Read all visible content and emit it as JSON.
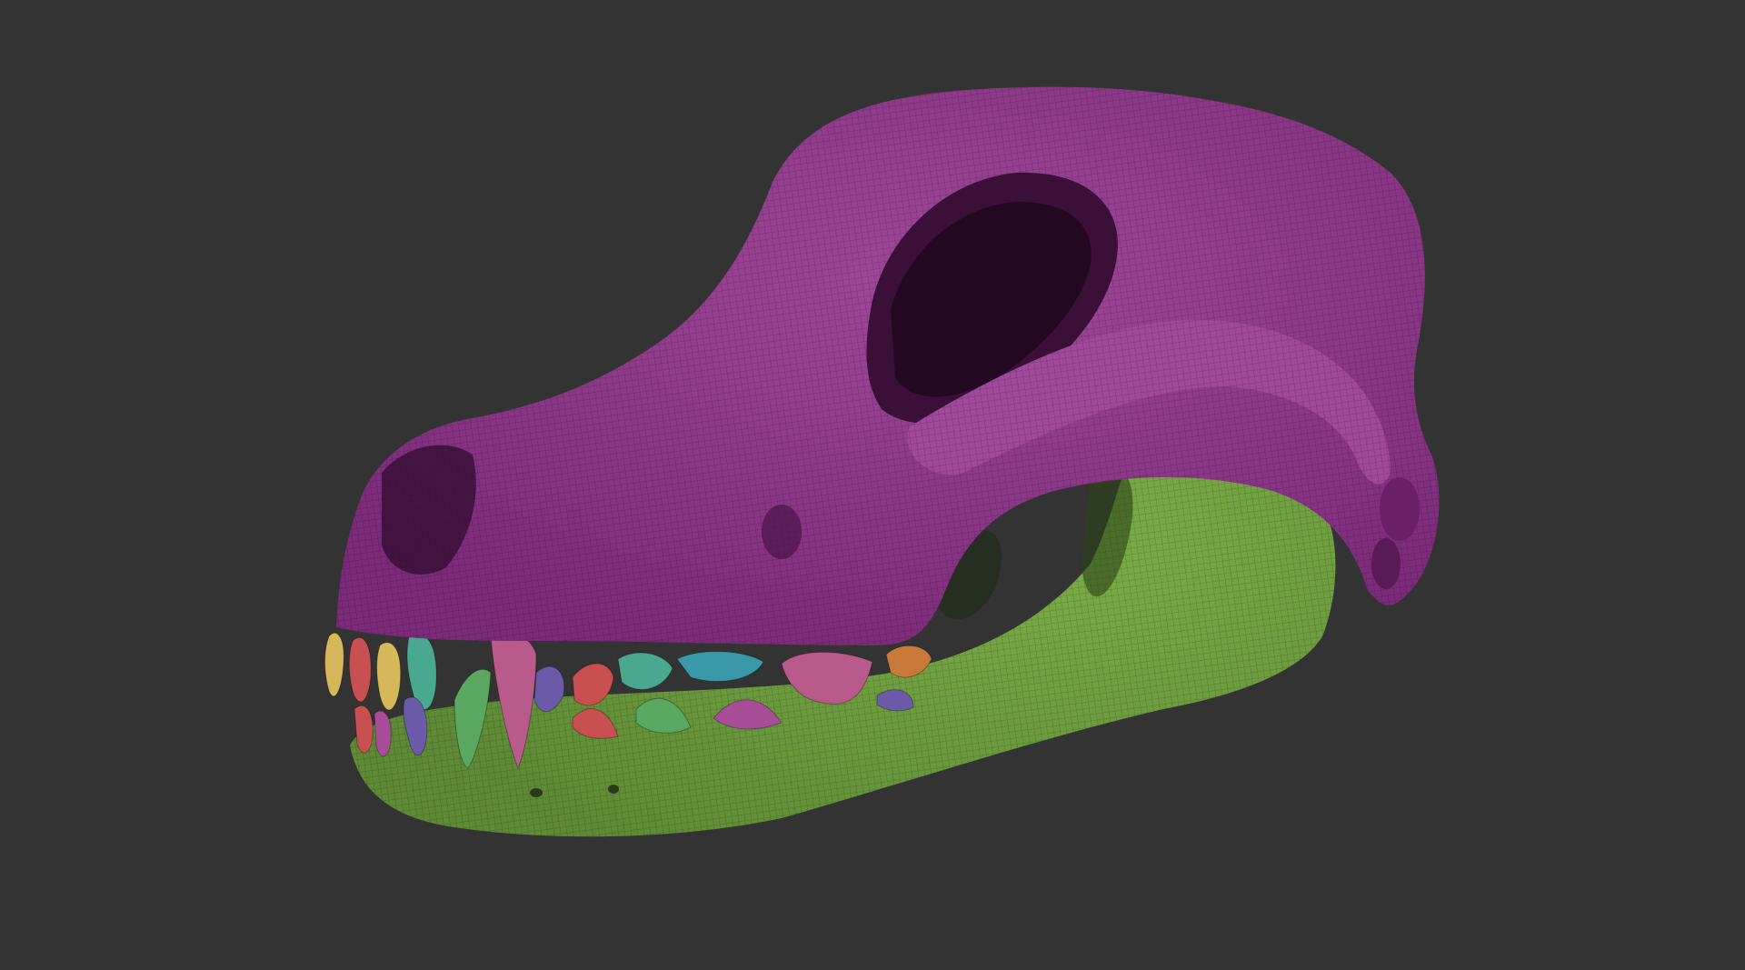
{
  "viewport": {
    "background_color": "#333333"
  },
  "model": {
    "subject": "dog-skull-sculpt",
    "polygroup_colors": {
      "cranium": "#7a2a78",
      "cranium_highlight": "#a0489a",
      "mandible": "#5e8a35",
      "mandible_highlight": "#7cae48",
      "teeth": [
        "#d4b85a",
        "#c85050",
        "#4aa890",
        "#6a5aa8",
        "#3a98a8",
        "#b85a8a",
        "#c87a3a",
        "#5aa860",
        "#a84e98"
      ]
    },
    "shading": "wireframe-mesh-overlay"
  }
}
